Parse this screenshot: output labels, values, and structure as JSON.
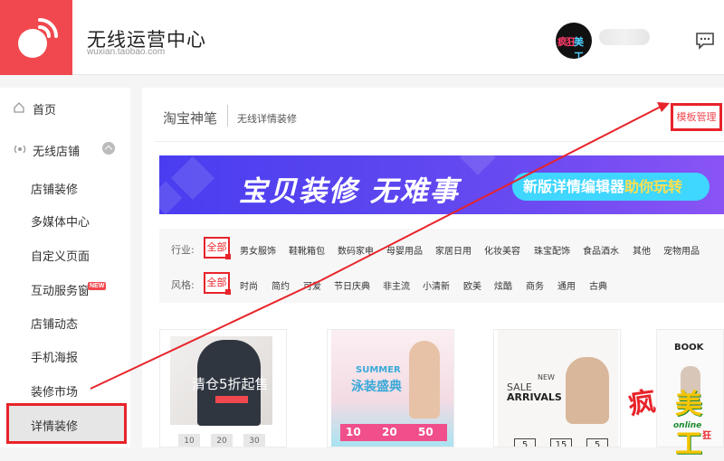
{
  "header": {
    "title": "无线运营中心",
    "subtitle": "wuxian.taobao.com",
    "avatar_text_a": "疯狂",
    "avatar_text_b": "美工"
  },
  "sidebar": {
    "items": [
      {
        "label": "首页",
        "icon": "home-icon"
      },
      {
        "label": "无线店铺",
        "icon": "wireless-icon"
      },
      {
        "label": "店铺装修"
      },
      {
        "label": "多媒体中心"
      },
      {
        "label": "自定义页面"
      },
      {
        "label": "互动服务窗",
        "badge": "NEW"
      },
      {
        "label": "店铺动态"
      },
      {
        "label": "手机海报"
      },
      {
        "label": "装修市场"
      },
      {
        "label": "详情装修"
      }
    ],
    "active_index": 9
  },
  "main": {
    "breadcrumb_title": "淘宝神笔",
    "breadcrumb_sub": "无线详情装修",
    "template_button": "模板管理",
    "banner": {
      "headline": "宝贝装修 无难事",
      "pill_a": "新版详情编辑器",
      "pill_b": "助你玩转"
    },
    "filters": {
      "industry_label": "行业:",
      "industry_selected": "全部",
      "industry_options": [
        "男女服饰",
        "鞋靴箱包",
        "数码家电",
        "母婴用品",
        "家居日用",
        "化妆美容",
        "珠宝配饰",
        "食品酒水",
        "其他",
        "宠物用品"
      ],
      "style_label": "风格:",
      "style_selected": "全部",
      "style_options": [
        "时尚",
        "简约",
        "可爱",
        "节日庆典",
        "非主流",
        "小清新",
        "欧美",
        "炫酷",
        "商务",
        "通用",
        "古典"
      ]
    },
    "cards": {
      "c1_text": "清仓5折起售",
      "c1_prices": [
        "10",
        "20",
        "30"
      ],
      "c2_small": "SUMMER",
      "c2_title": "泳装盛典",
      "c2_prices": [
        "10",
        "20",
        "50"
      ],
      "c3_sale": "SALE",
      "c3_new": "NEW",
      "c3_arrivals": "ARRIVALS",
      "c3_nums": [
        "5",
        "15",
        "5"
      ],
      "c4_text": "BOOK"
    }
  },
  "watermark": {
    "a": "疯",
    "b": "美工",
    "c": "online",
    "d": "狂"
  },
  "colors": {
    "brand_red": "#f0484e",
    "highlight_red": "#e8232a",
    "banner_blue": "#4a3df0",
    "pill_cyan": "#3fd6ff"
  }
}
